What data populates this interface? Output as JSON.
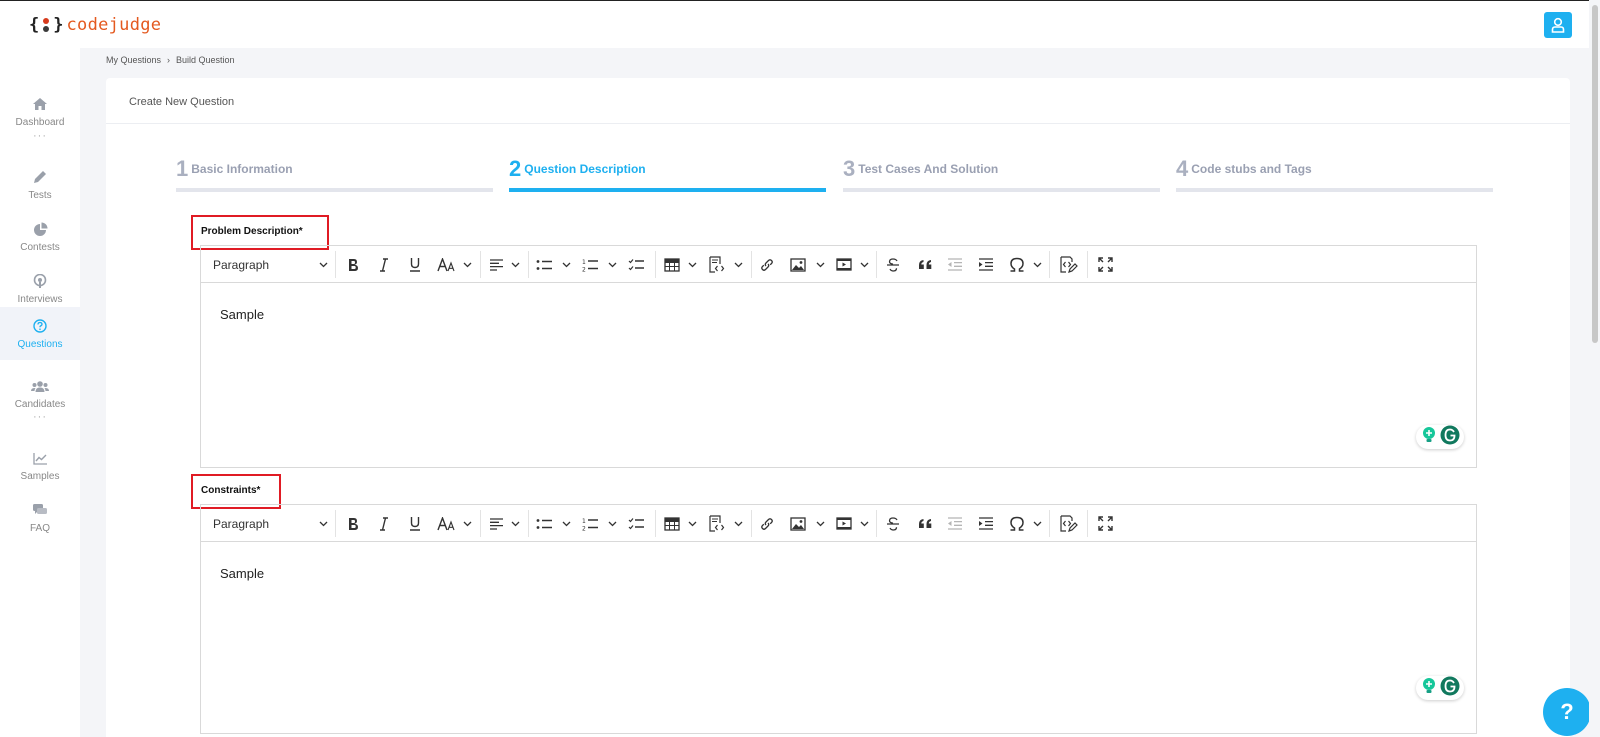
{
  "app": {
    "logo_text": "codejudge"
  },
  "sidebar": {
    "items": [
      {
        "label": "Dashboard",
        "icon": "home-icon"
      },
      {
        "label": "Tests",
        "icon": "pen-icon"
      },
      {
        "label": "Contests",
        "icon": "pie-chart-icon"
      },
      {
        "label": "Interviews",
        "icon": "podcast-icon"
      },
      {
        "label": "Questions",
        "icon": "question-circle-icon",
        "active": true
      },
      {
        "label": "Candidates",
        "icon": "users-icon"
      },
      {
        "label": "Samples",
        "icon": "line-chart-icon"
      },
      {
        "label": "FAQ",
        "icon": "comments-icon"
      }
    ],
    "dots": "···"
  },
  "breadcrumb": {
    "item1": "My Questions",
    "separator": "›",
    "item2": "Build Question"
  },
  "card": {
    "title": "Create New Question"
  },
  "steps": [
    {
      "num": "1",
      "label": "Basic Information"
    },
    {
      "num": "2",
      "label": "Question Description",
      "active": true
    },
    {
      "num": "3",
      "label": "Test Cases And Solution"
    },
    {
      "num": "4",
      "label": "Code stubs and Tags"
    }
  ],
  "fields": {
    "problem": {
      "label": "Problem Description*",
      "format": "Paragraph",
      "content": "Sample"
    },
    "constraints": {
      "label": "Constraints*",
      "format": "Paragraph",
      "content": "Sample"
    }
  },
  "help": {
    "label": "?"
  },
  "colors": {
    "accent": "#1eb0f0",
    "logo": "#e4591f",
    "highlight": "#e01b24"
  }
}
